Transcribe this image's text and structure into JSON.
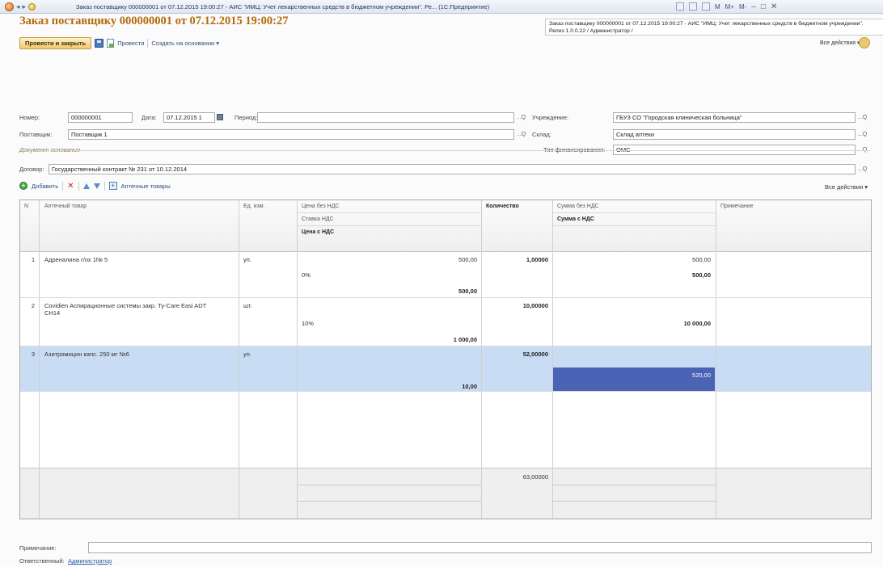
{
  "window": {
    "title": "Заказ поставщику 000000001 от 07.12.2015 19:00:27 - АИС \"ИМЦ: Учет лекарственных средств в бюджетном учреждении\". Ре...   (1С:Предприятие)",
    "controls": [
      "M",
      "M+",
      "M-"
    ]
  },
  "document": {
    "title": "Заказ поставщику 000000001 от 07.12.2015 19:00:27",
    "tooltip": "Заказ поставщику 000000001 от 07.12.2015 19:00:27 - АИС \"ИМЦ: Учет лекарственных средств в бюджетном учреждении\". Релиз 1.0.0.22 / Администратор /"
  },
  "toolbar": {
    "post_close": "Провести и закрыть",
    "post": "Провести",
    "create_basis": "Создать на основании",
    "all_actions": "Все действия"
  },
  "form": {
    "number_label": "Номер:",
    "number_value": "000000001",
    "date_label": "Дата:",
    "date_value": "07.12.2015 1",
    "period_label": "Период:",
    "period_value": "",
    "supplier_label": "Поставщик:",
    "supplier_value": "Поставщик 1",
    "institution_label": "Учреждение:",
    "institution_value": "ГБУЗ СО  \"Городская клиническая больница\"",
    "warehouse_label": "Склад:",
    "warehouse_value": "Склад аптеки",
    "funding_label": "Тип финансирования:",
    "funding_value": "ОМС",
    "basis_caption": "Документ основания",
    "contract_label": "Договор:",
    "contract_value": "Государственный контракт № 231 от 10.12.2014",
    "note_label": "Примечание:",
    "note_value": "",
    "responsible_label": "Ответственный:",
    "responsible_value": "Администратор"
  },
  "table_toolbar": {
    "add": "Добавить",
    "pharmacy_goods": "Аптечные товары",
    "all_actions": "Все действия"
  },
  "table": {
    "headers": {
      "n": "N",
      "product": "Аптечный товар",
      "unit": "Ед. изм.",
      "price_no_vat": "Цена без НДС",
      "vat_rate": "Ставка НДС",
      "price_vat": "Цена с НДС",
      "qty": "Количество",
      "sum_no_vat": "Сумма без НДС",
      "sum_vat": "Сумма с НДС",
      "note": "Примечание"
    },
    "rows": [
      {
        "n": "1",
        "product": "Адреналина г/ох 1№ 5",
        "unit": "уп.",
        "price_no_vat": "500,00",
        "vat_rate": "0%",
        "price_vat": "500,00",
        "qty": "1,00000",
        "sum_no_vat": "500,00",
        "sum_vat": "500,00"
      },
      {
        "n": "2",
        "product": "Covidien Аспирационные системы закр. Ty-Care Easi ADT CH14",
        "unit": "шт.",
        "price_no_vat": "",
        "vat_rate": "10%",
        "price_vat": "1 000,00",
        "qty": "10,00000",
        "sum_no_vat": "",
        "sum_vat": "10 000,00"
      },
      {
        "n": "3",
        "product": "Азитромицин капс. 250 мг №6",
        "unit": "уп.",
        "price_no_vat": "",
        "vat_rate": "",
        "price_vat": "10,00",
        "qty": "52,00000",
        "sum_no_vat": "",
        "sum_vat": "520,00"
      }
    ],
    "total_qty": "63,00000"
  }
}
